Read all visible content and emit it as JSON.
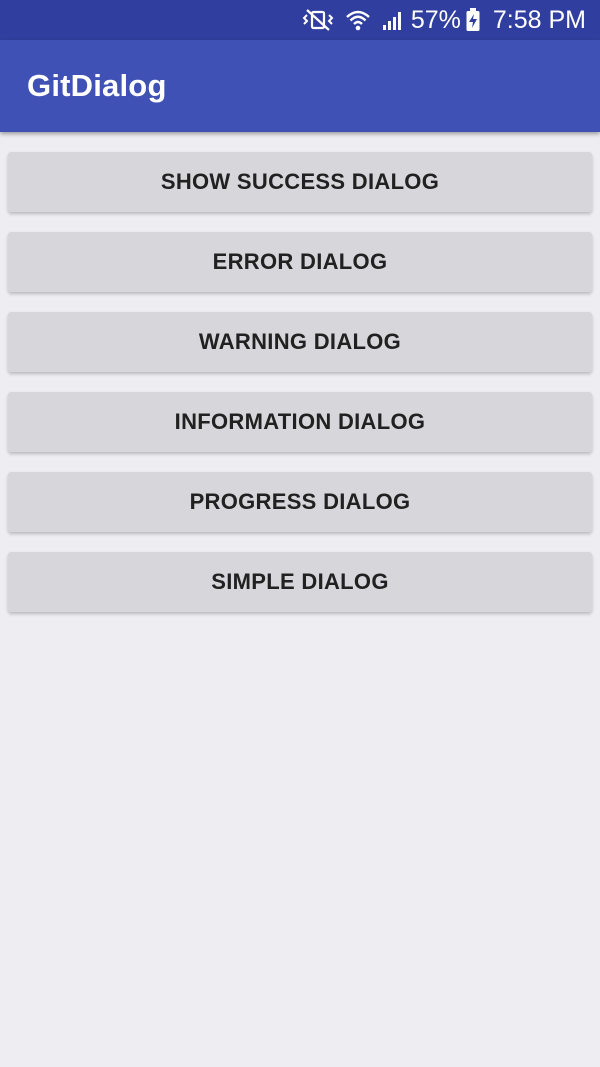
{
  "status_bar": {
    "icons": [
      "vibrate-mute-icon",
      "wifi-icon",
      "signal-icon",
      "battery-charging-icon"
    ],
    "battery_percent": "57%",
    "time": "7:58 PM"
  },
  "app_bar": {
    "title": "GitDialog",
    "color": "#3f51b5",
    "status_color": "#303f9f"
  },
  "buttons": [
    {
      "label": "SHOW SUCCESS DIALOG"
    },
    {
      "label": "ERROR DIALOG"
    },
    {
      "label": "WARNING DIALOG"
    },
    {
      "label": "INFORMATION DIALOG"
    },
    {
      "label": "PROGRESS DIALOG"
    },
    {
      "label": "SIMPLE DIALOG"
    }
  ]
}
